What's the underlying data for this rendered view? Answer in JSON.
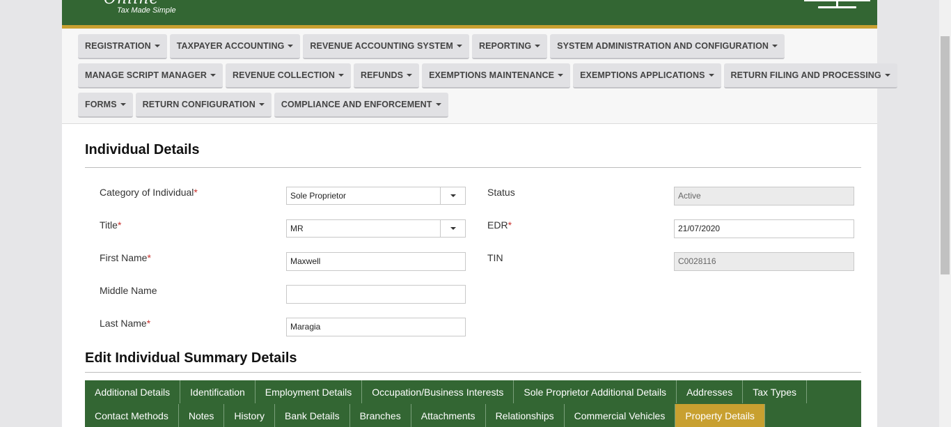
{
  "header": {
    "logo_text": "Online",
    "tagline": "Tax Made Simple"
  },
  "nav": {
    "row1": [
      "REGISTRATION",
      "TAXPAYER ACCOUNTING",
      "REVENUE ACCOUNTING SYSTEM",
      "REPORTING",
      "SYSTEM ADMINISTRATION AND CONFIGURATION"
    ],
    "row2": [
      "MANAGE SCRIPT MANAGER",
      "REVENUE COLLECTION",
      "REFUNDS",
      "EXEMPTIONS MAINTENANCE",
      "EXEMPTIONS APPLICATIONS",
      "RETURN FILING AND PROCESSING"
    ],
    "row3": [
      "FORMS",
      "RETURN CONFIGURATION",
      "COMPLIANCE AND ENFORCEMENT"
    ]
  },
  "details": {
    "title": "Individual Details",
    "category_label": "Category of Individual",
    "category_value": "Sole Proprietor",
    "title_label": "Title",
    "title_value": "MR",
    "first_name_label": "First Name",
    "first_name_value": "Maxwell",
    "middle_name_label": "Middle Name",
    "middle_name_value": "",
    "last_name_label": "Last Name",
    "last_name_value": "Maragia",
    "status_label": "Status",
    "status_value": "Active",
    "edr_label": "EDR",
    "edr_value": "21/07/2020",
    "tin_label": "TIN",
    "tin_value": "C0028116",
    "required_mark": "*"
  },
  "summary": {
    "title": "Edit Individual Summary Details",
    "tabs_row1": [
      "Additional Details",
      "Identification",
      "Employment Details",
      "Occupation/Business Interests",
      "Sole Proprietor Additional Details",
      "Addresses",
      "Tax Types"
    ],
    "tabs_row2": [
      "Contact Methods",
      "Notes",
      "History",
      "Bank Details",
      "Branches",
      "Attachments",
      "Relationships",
      "Commercial Vehicles",
      "Property Details"
    ],
    "active_tab": "Property Details"
  },
  "colors": {
    "brand_green": "#336633",
    "accent_gold": "#c8a030",
    "required_red": "#c9302c"
  }
}
